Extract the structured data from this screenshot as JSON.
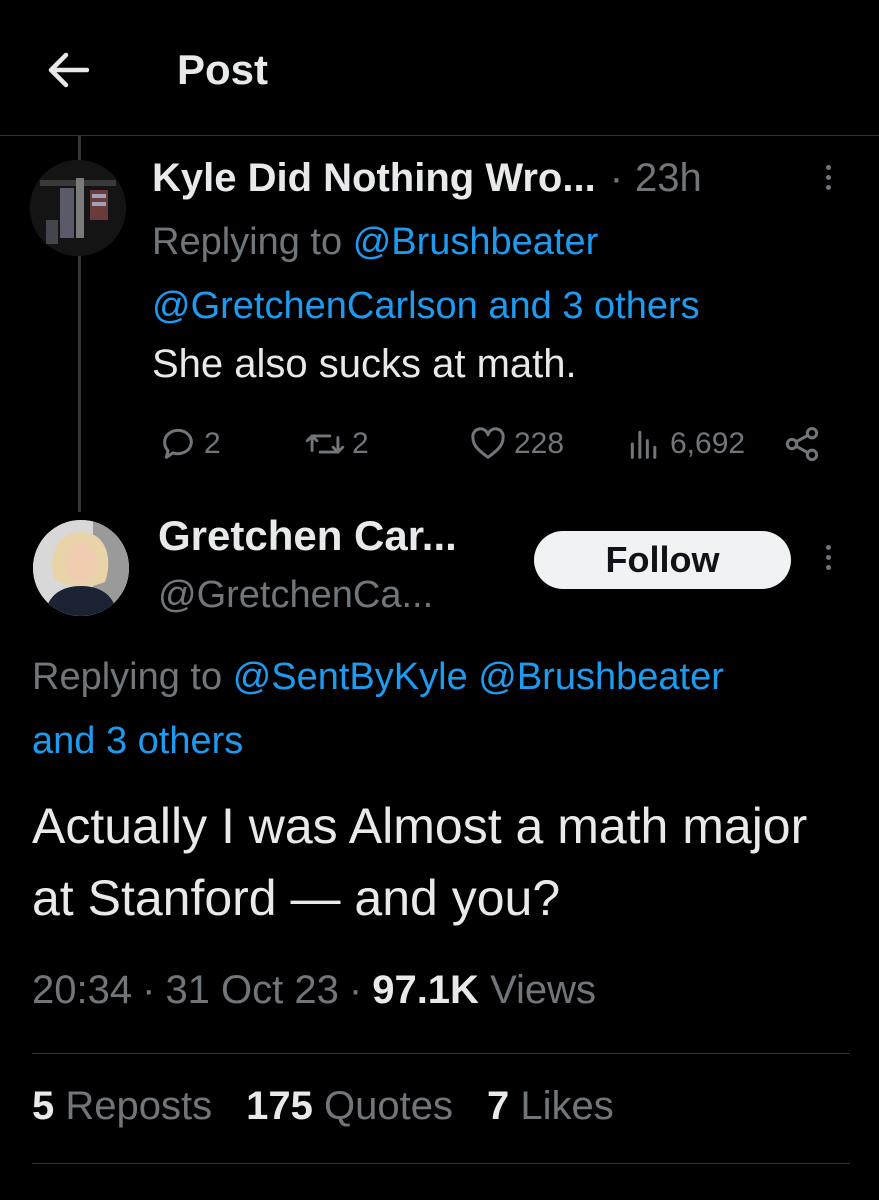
{
  "header": {
    "title": "Post"
  },
  "parent_reply": {
    "display_name": "Kyle Did Nothing Wro...",
    "separator": "·",
    "time": "23h",
    "replying_prefix": "Replying to",
    "replying_handle_1": "@Brushbeater",
    "replying_handle_2": "@GretchenCarlson",
    "replying_others": "and 3 others",
    "text": "She also sucks at math.",
    "stats": {
      "replies": "2",
      "reposts": "2",
      "likes": "228",
      "views": "6,692"
    }
  },
  "main_post": {
    "display_name": "Gretchen Car...",
    "handle": "@GretchenCa...",
    "follow_label": "Follow",
    "replying_prefix": "Replying to",
    "replying_handle_1": "@SentByKyle",
    "replying_handle_2": "@Brushbeater",
    "replying_others": "and 3 others",
    "text": "Actually I was Almost a math major at Stanford — and you?",
    "time": "20:34",
    "date": "31 Oct 23",
    "separator": "·",
    "views_count": "97.1K",
    "views_label": "Views"
  },
  "engagement": {
    "reposts_count": "5",
    "reposts_label": "Reposts",
    "quotes_count": "175",
    "quotes_label": "Quotes",
    "likes_count": "7",
    "likes_label": "Likes"
  },
  "colors": {
    "background": "#000000",
    "text": "#e7e9ea",
    "muted": "#71767b",
    "link": "#1d9bf0",
    "divider": "#2f3336",
    "button_bg": "#eff3f4"
  }
}
